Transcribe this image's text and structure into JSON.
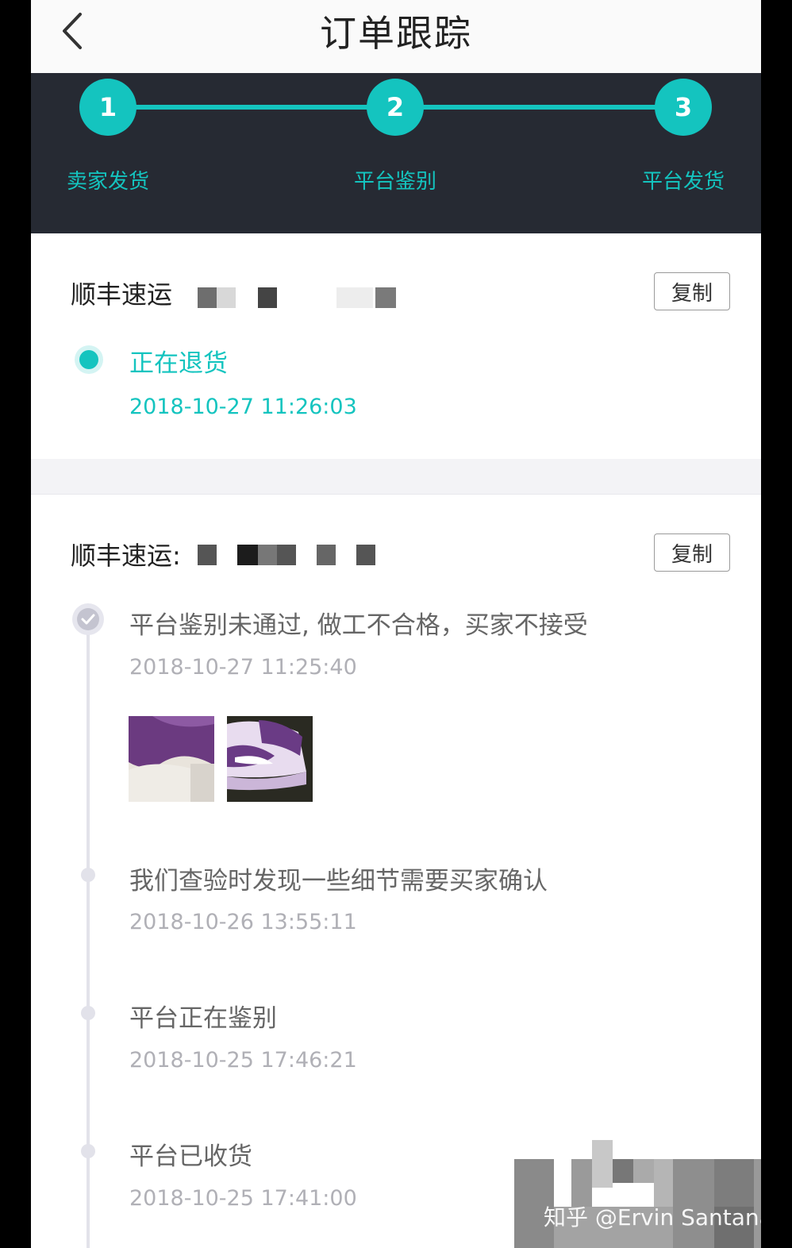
{
  "header": {
    "title": "订单跟踪"
  },
  "colors": {
    "accent": "#14c4bf",
    "stepper_bg": "#262a33"
  },
  "steps": [
    {
      "number": "1",
      "label": "卖家发货"
    },
    {
      "number": "2",
      "label": "平台鉴别"
    },
    {
      "number": "3",
      "label": "平台发货"
    }
  ],
  "shipment_1": {
    "carrier": "顺丰速运",
    "copy_label": "复制",
    "events": [
      {
        "title": "正在退货",
        "time": "2018-10-27 11:26:03"
      }
    ]
  },
  "shipment_2": {
    "carrier": "顺丰速运:",
    "copy_label": "复制",
    "events": [
      {
        "title": "平台鉴别未通过, 做工不合格，买家不接受",
        "time": "2018-10-27 11:25:40"
      },
      {
        "title": "我们查验时发现一些细节需要买家确认",
        "time": "2018-10-26 13:55:11"
      },
      {
        "title": "平台正在鉴别",
        "time": "2018-10-25 17:46:21"
      },
      {
        "title": "平台已收货",
        "time": "2018-10-25 17:41:00"
      }
    ]
  },
  "watermark": "知乎 @Ervin Santana"
}
